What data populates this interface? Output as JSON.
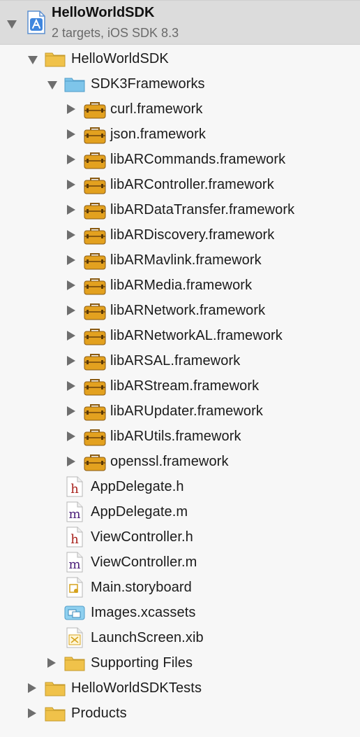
{
  "project": {
    "name": "HelloWorldSDK",
    "subtitle": "2 targets, iOS SDK 8.3"
  },
  "tree": [
    {
      "label": "HelloWorldSDK",
      "kind": "folder",
      "state": "open"
    },
    {
      "label": "SDK3Frameworks",
      "kind": "folder-blue",
      "state": "open"
    },
    {
      "label": "curl.framework",
      "kind": "framework",
      "state": "closed"
    },
    {
      "label": "json.framework",
      "kind": "framework",
      "state": "closed"
    },
    {
      "label": "libARCommands.framework",
      "kind": "framework",
      "state": "closed"
    },
    {
      "label": "libARController.framework",
      "kind": "framework",
      "state": "closed"
    },
    {
      "label": "libARDataTransfer.framework",
      "kind": "framework",
      "state": "closed"
    },
    {
      "label": "libARDiscovery.framework",
      "kind": "framework",
      "state": "closed"
    },
    {
      "label": "libARMavlink.framework",
      "kind": "framework",
      "state": "closed"
    },
    {
      "label": "libARMedia.framework",
      "kind": "framework",
      "state": "closed"
    },
    {
      "label": "libARNetwork.framework",
      "kind": "framework",
      "state": "closed"
    },
    {
      "label": "libARNetworkAL.framework",
      "kind": "framework",
      "state": "closed"
    },
    {
      "label": "libARSAL.framework",
      "kind": "framework",
      "state": "closed"
    },
    {
      "label": "libARStream.framework",
      "kind": "framework",
      "state": "closed"
    },
    {
      "label": "libARUpdater.framework",
      "kind": "framework",
      "state": "closed"
    },
    {
      "label": "libARUtils.framework",
      "kind": "framework",
      "state": "closed"
    },
    {
      "label": "openssl.framework",
      "kind": "framework",
      "state": "closed"
    },
    {
      "label": "AppDelegate.h",
      "kind": "header-file"
    },
    {
      "label": "AppDelegate.m",
      "kind": "source-file"
    },
    {
      "label": "ViewController.h",
      "kind": "header-file"
    },
    {
      "label": "ViewController.m",
      "kind": "source-file"
    },
    {
      "label": "Main.storyboard",
      "kind": "storyboard-file"
    },
    {
      "label": "Images.xcassets",
      "kind": "xcassets-file"
    },
    {
      "label": "LaunchScreen.xib",
      "kind": "xib-file"
    },
    {
      "label": "Supporting Files",
      "kind": "folder",
      "state": "closed"
    },
    {
      "label": "HelloWorldSDKTests",
      "kind": "folder",
      "state": "closed"
    },
    {
      "label": "Products",
      "kind": "folder",
      "state": "closed"
    }
  ],
  "colors": {
    "folder": "#f0c24a",
    "folder_blue": "#7ec5ea",
    "framework": "#e3a11f",
    "header_letter": "#a8201a",
    "source_letter": "#4b1f7a"
  }
}
